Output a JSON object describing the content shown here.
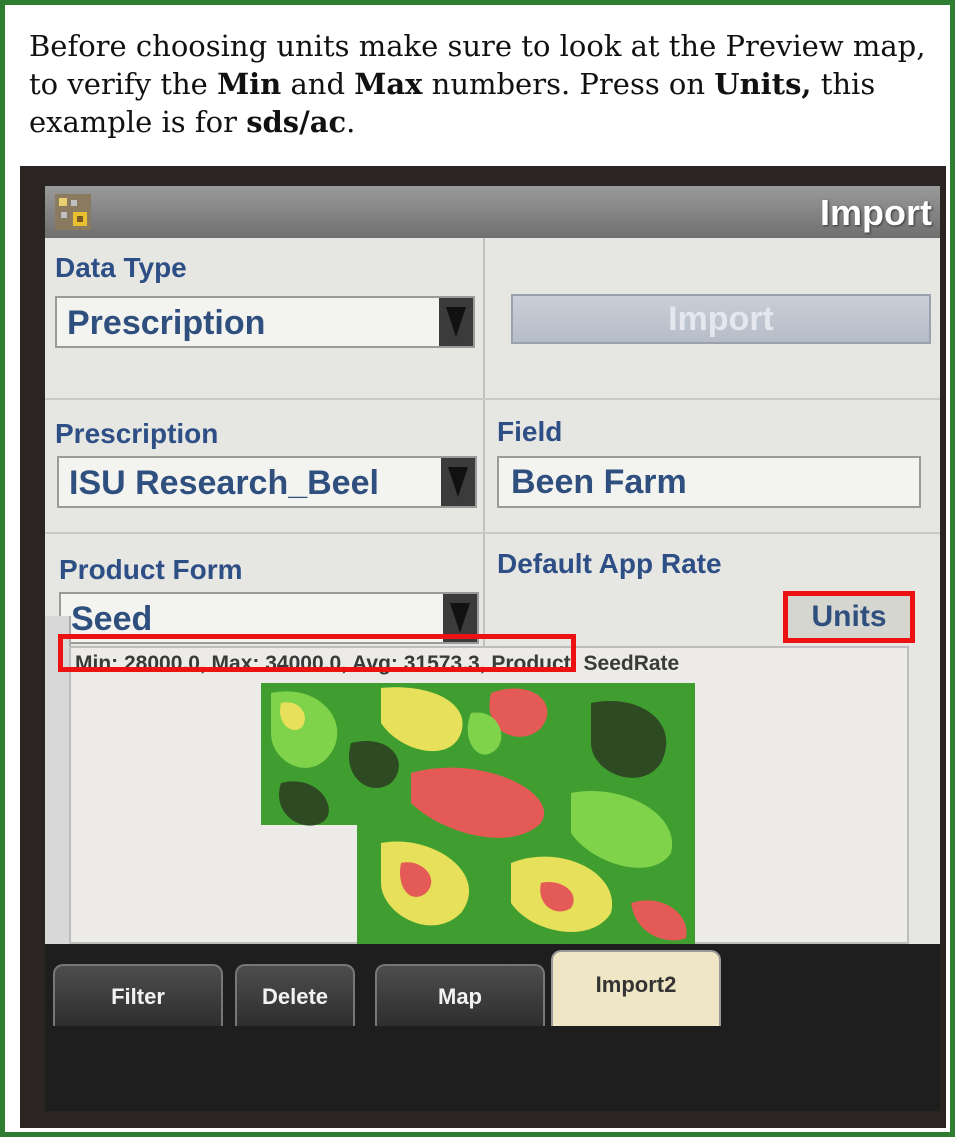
{
  "instructions": {
    "p1": "Before choosing units make sure to look at the Preview map, to verify the ",
    "min": "Min",
    "and": " and ",
    "max": "Max",
    "p2": " numbers. Press on ",
    "units": "Units,",
    "p3": " this example is for ",
    "sdsac": "sds/ac",
    "p4": "."
  },
  "window": {
    "title": "Import"
  },
  "form": {
    "data_type_label": "Data Type",
    "data_type_value": "Prescription",
    "import_button": "Import",
    "prescription_label": "Prescription",
    "prescription_value": "ISU Research_Beel",
    "field_label": "Field",
    "field_value": "Been Farm",
    "product_form_label": "Product Form",
    "product_form_value": "Seed",
    "default_app_rate_label": "Default App Rate",
    "units_button": "Units"
  },
  "preview": {
    "stats": "Min: 28000.0, Max: 34000.0, Avg: 31573.3, Product: SeedRate",
    "min": 28000.0,
    "max": 34000.0,
    "avg": 31573.3,
    "product": "SeedRate",
    "zone_colors": [
      "#3f9e2f",
      "#7fd34a",
      "#e6e05a",
      "#e45a56",
      "#2e4a22"
    ]
  },
  "tabs": [
    {
      "label": "Filter"
    },
    {
      "label": "Delete"
    },
    {
      "label": "Map"
    },
    {
      "label": "Import2",
      "active": true
    }
  ],
  "colors": {
    "frame": "#2e7d32",
    "highlight": "#e11111"
  }
}
